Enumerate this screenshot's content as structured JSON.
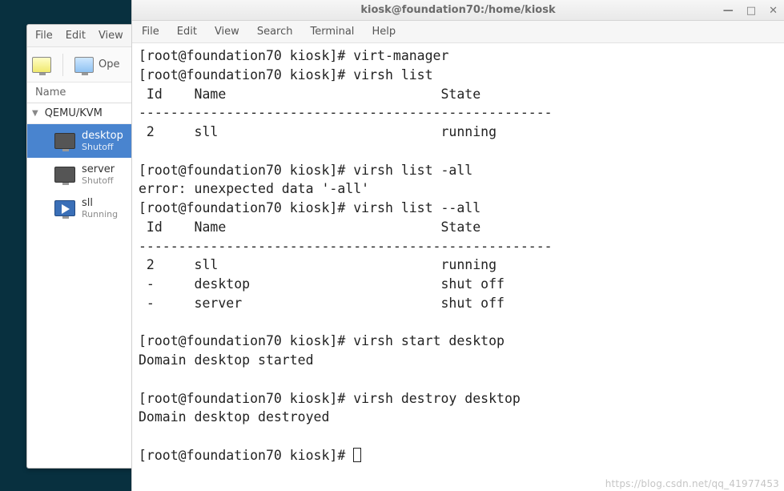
{
  "virt_manager": {
    "menubar": [
      "File",
      "Edit",
      "View"
    ],
    "toolbar": {
      "open_label": "Ope"
    },
    "column_header": "Name",
    "group_label": "QEMU/KVM",
    "vms": [
      {
        "name": "desktop",
        "state": "Shutoff",
        "selected": true,
        "playing": false
      },
      {
        "name": "server",
        "state": "Shutoff",
        "selected": false,
        "playing": false
      },
      {
        "name": "sll",
        "state": "Running",
        "selected": false,
        "playing": true
      }
    ]
  },
  "terminal": {
    "title": "kiosk@foundation70:/home/kiosk",
    "menubar": [
      "File",
      "Edit",
      "View",
      "Search",
      "Terminal",
      "Help"
    ],
    "win_controls": {
      "minimize": "—",
      "maximize": "□",
      "close": "✕"
    },
    "lines": [
      "[root@foundation70 kiosk]# virt-manager",
      "[root@foundation70 kiosk]# virsh list",
      " Id    Name                           State",
      "----------------------------------------------------",
      " 2     sll                            running",
      "",
      "[root@foundation70 kiosk]# virsh list -all",
      "error: unexpected data '-all'",
      "[root@foundation70 kiosk]# virsh list --all",
      " Id    Name                           State",
      "----------------------------------------------------",
      " 2     sll                            running",
      " -     desktop                        shut off",
      " -     server                         shut off",
      "",
      "[root@foundation70 kiosk]# virsh start desktop",
      "Domain desktop started",
      "",
      "[root@foundation70 kiosk]# virsh destroy desktop",
      "Domain desktop destroyed",
      "",
      "[root@foundation70 kiosk]# "
    ]
  },
  "watermark": "https://blog.csdn.net/qq_41977453"
}
